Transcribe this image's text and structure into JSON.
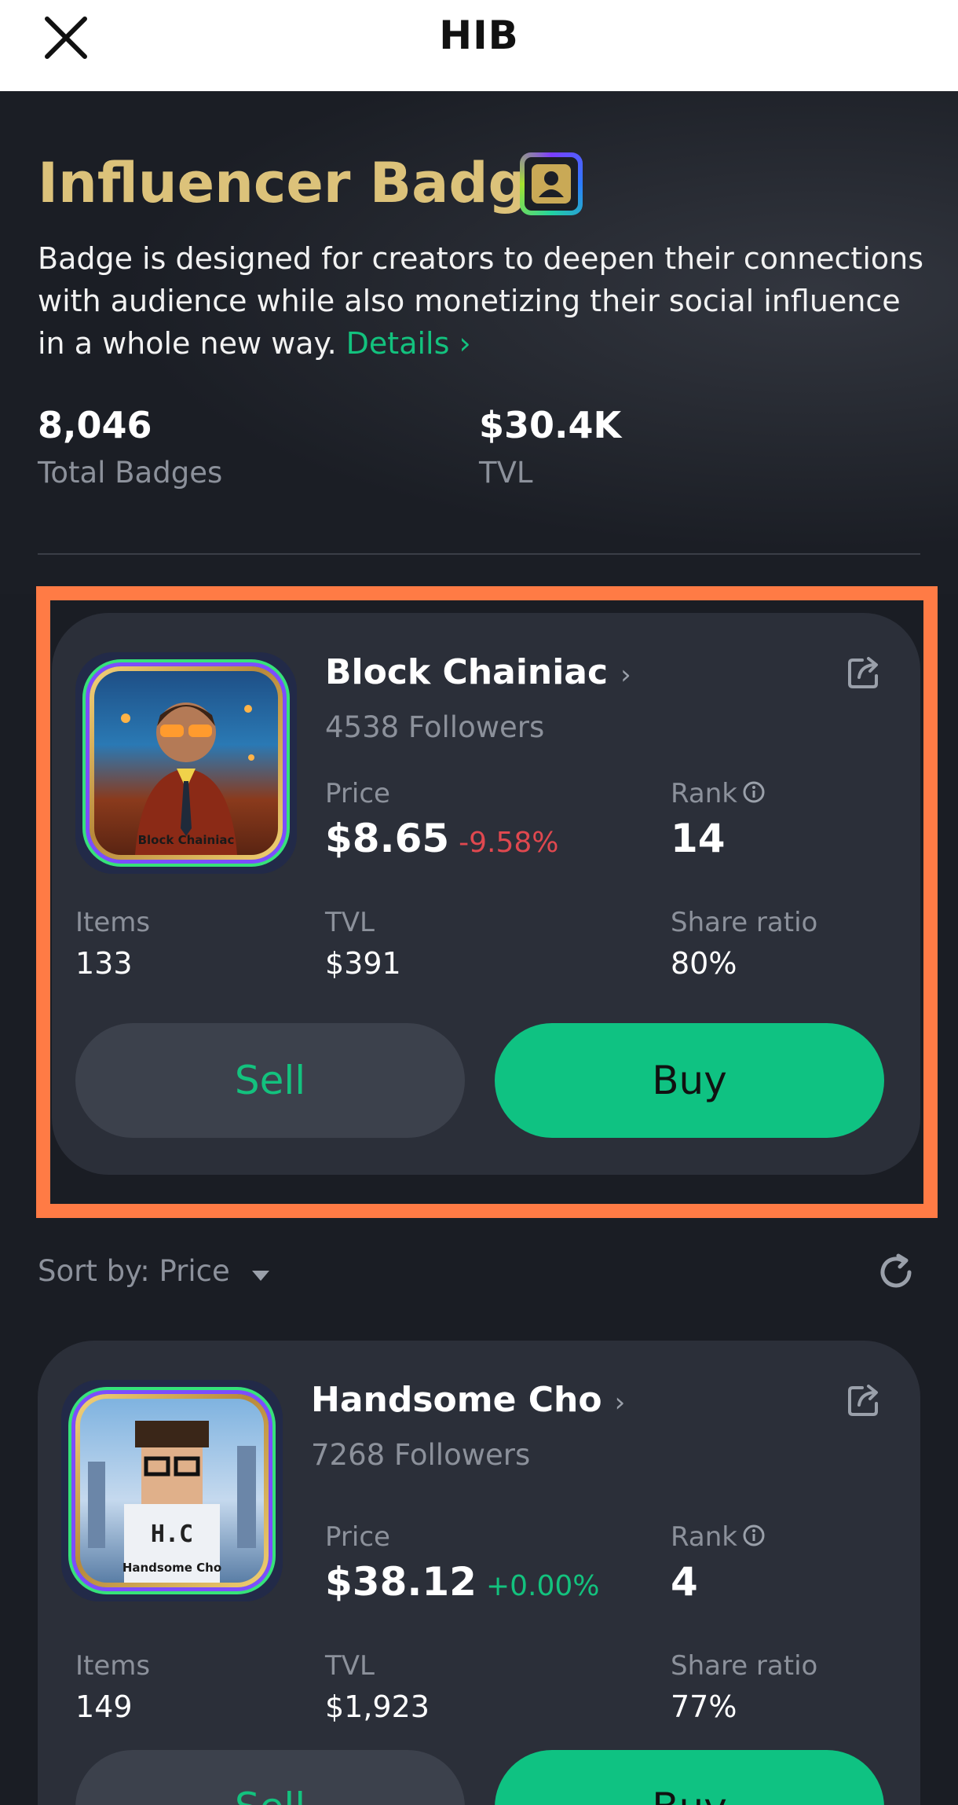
{
  "header": {
    "title": "HIB"
  },
  "hero": {
    "title": "Influencer Badge",
    "description": "Badge is designed for creators to deepen their connections with audience while also monetizing their social influence in a whole new way.",
    "details_label": "Details",
    "stats": [
      {
        "value": "8,046",
        "label": "Total Badges"
      },
      {
        "value": "$30.4K",
        "label": "TVL"
      }
    ]
  },
  "badges": [
    {
      "name": "Block Chainiac",
      "followers": "4538 Followers",
      "price_label": "Price",
      "price": "$8.65",
      "change": "-9.58%",
      "rank_label": "Rank",
      "rank": "14",
      "items_label": "Items",
      "items": "133",
      "tvl_label": "TVL",
      "tvl": "$391",
      "share_label": "Share ratio",
      "share": "80%",
      "avatar_caption": "Block Chainiac",
      "sell_label": "Sell",
      "buy_label": "Buy"
    },
    {
      "name": "Handsome Cho",
      "followers": "7268 Followers",
      "price_label": "Price",
      "price": "$38.12",
      "change": "+0.00%",
      "rank_label": "Rank",
      "rank": "4",
      "items_label": "Items",
      "items": "149",
      "tvl_label": "TVL",
      "tvl": "$1,923",
      "share_label": "Share ratio",
      "share": "77%",
      "avatar_caption": "Handsome Cho",
      "sell_label": "Sell",
      "buy_label": "Buy"
    }
  ],
  "sort": {
    "label": "Sort by: Price"
  },
  "colors": {
    "accent_green": "#13c27e",
    "gold": "#dcc27a",
    "highlight": "#ff7b45",
    "negative": "#e0484f"
  }
}
